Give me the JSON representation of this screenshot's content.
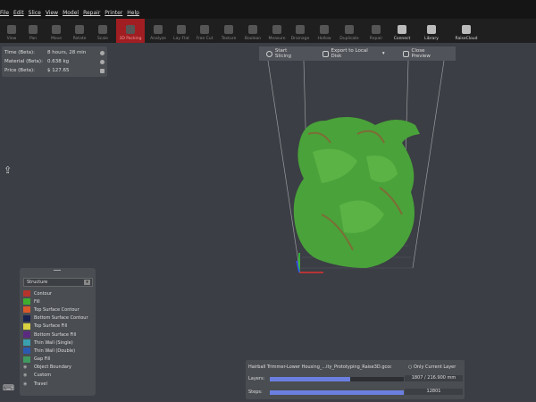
{
  "menu": [
    "File",
    "Edit",
    "Slice",
    "View",
    "Model",
    "Repair",
    "Printer",
    "Help"
  ],
  "toolbar": [
    {
      "label": "View"
    },
    {
      "label": "Pan"
    },
    {
      "label": "Move"
    },
    {
      "label": "Rotate"
    },
    {
      "label": "Scale"
    },
    {
      "label": "3D Packing",
      "active": true
    },
    {
      "label": "Analyze"
    },
    {
      "label": "Lay Flat"
    },
    {
      "label": "Free Cut"
    },
    {
      "label": "Texture"
    },
    {
      "label": "Boolean"
    },
    {
      "label": "Measure"
    },
    {
      "label": "Drainage"
    },
    {
      "label": "Hollow"
    },
    {
      "label": "Duplicate"
    },
    {
      "label": "Repair"
    },
    {
      "label": "Connect"
    },
    {
      "label": "Library"
    },
    {
      "label": "RaiseCloud"
    }
  ],
  "stats": {
    "time_label": "Time (Beta):",
    "time": "8 hours, 28 min",
    "material_label": "Material (Beta):",
    "material": "0.638 kg",
    "price_label": "Price (Beta):",
    "price": "$ 127.65"
  },
  "preview": {
    "start": "Start Slicing",
    "export": "Export to Local Disk",
    "close": "Close Preview"
  },
  "legend": {
    "mode": "Structure",
    "items": [
      {
        "label": "Contour",
        "color": "#b5342c"
      },
      {
        "label": "Fill",
        "color": "#3fae2e"
      },
      {
        "label": "Top Surface Contour",
        "color": "#d9582a"
      },
      {
        "label": "Bottom Surface Contour",
        "color": "#1a2350"
      },
      {
        "label": "Top Surface Fill",
        "color": "#d8d040"
      },
      {
        "label": "Bottom Surface Fill",
        "color": "#5a2a80"
      },
      {
        "label": "Thin Wall (Single)",
        "color": "#3aa0b0"
      },
      {
        "label": "Thin Wall (Double)",
        "color": "#2a5ab0"
      },
      {
        "label": "Gap Fill",
        "color": "#3f9a60"
      }
    ],
    "toggles": [
      "Object Boundary",
      "Custom",
      "Travel"
    ]
  },
  "bottom": {
    "file": "Hairball Trimmer-Lower Housing_...ity_Prototyping_Raise3D.gcode",
    "only_current": "Only Current Layer",
    "layers_label": "Layers:",
    "layers_value": "1807 / 216.900 mm",
    "layers_fraction": 0.6,
    "steps_label": "Steps:",
    "steps_value": "12801",
    "steps_fraction": 1.0
  }
}
